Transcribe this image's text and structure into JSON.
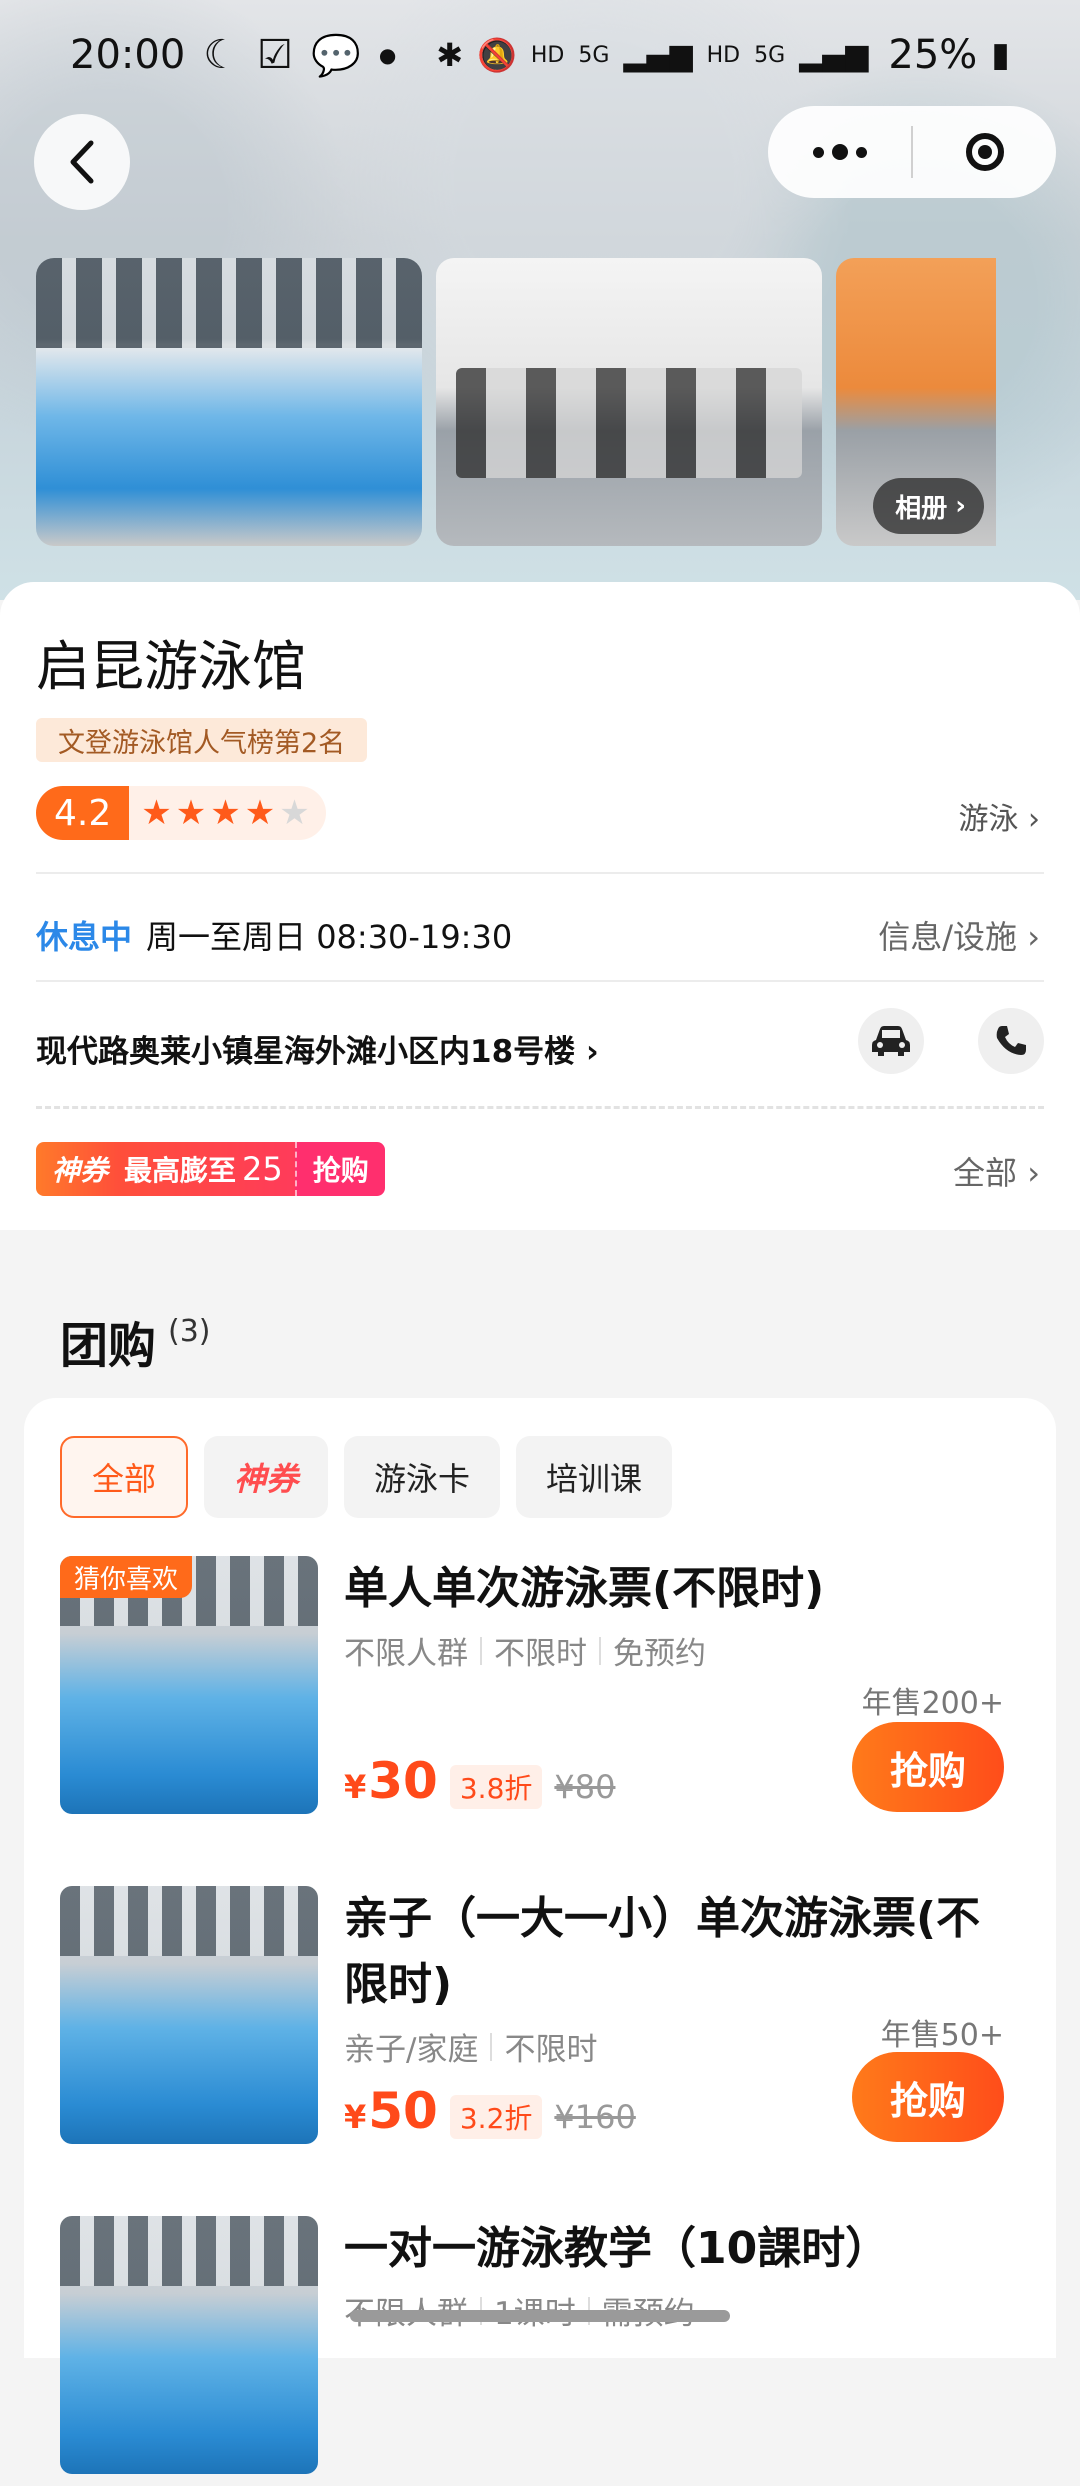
{
  "status_bar": {
    "time": "20:00",
    "signal1": "HD",
    "signal2": "5G",
    "signal3": "HD",
    "signal4": "5G",
    "battery": "25%"
  },
  "gallery": {
    "album_label": "相册"
  },
  "venue": {
    "name": "启昆游泳馆",
    "rank_badge": "文登游泳馆人气榜第2名",
    "score": "4.2",
    "stars_filled": 4,
    "category_link": "游泳",
    "status": "休息中",
    "hours": "周一至周日 08:30-19:30",
    "info_link": "信息/设施",
    "address": "现代路奥莱小镇星海外滩小区内18号楼"
  },
  "coupon": {
    "brand": "神券",
    "text_prefix": "最高膨至",
    "amount": "25",
    "grab": "抢购",
    "all_link": "全部"
  },
  "group_buy": {
    "title": "团购",
    "count": "(3)",
    "chips": [
      "全部",
      "神券",
      "游泳卡",
      "培训课"
    ],
    "deals": [
      {
        "badge": "猜你喜欢",
        "title": "单人单次游泳票(不限时)",
        "tags": [
          "不限人群",
          "不限时",
          "免预约"
        ],
        "sold": "年售200+",
        "currency": "¥",
        "price": "30",
        "discount": "3.8折",
        "original": "¥80",
        "button": "抢购"
      },
      {
        "title": "亲子（一大一小）单次游泳票(不限时)",
        "tags": [
          "亲子/家庭",
          "不限时"
        ],
        "sold": "年售50+",
        "currency": "¥",
        "price": "50",
        "discount": "3.2折",
        "original": "¥160",
        "button": "抢购"
      },
      {
        "title": "一对一游泳教学（10課时）",
        "tags": [
          "不限人群",
          "1课时",
          "需预约"
        ]
      }
    ]
  },
  "colors": {
    "accent": "#ff5a1a",
    "status_blue": "#2b88e8",
    "pink": "#ff2f6e"
  }
}
